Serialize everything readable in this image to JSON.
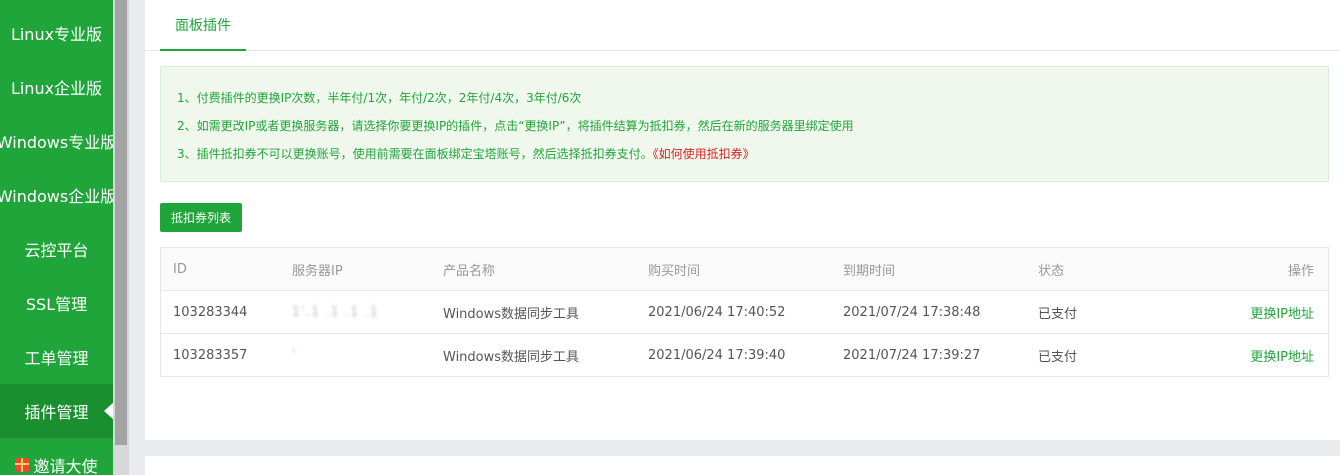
{
  "sidebar": {
    "items": [
      {
        "label": "Linux专业版"
      },
      {
        "label": "Linux企业版"
      },
      {
        "label": "Windows专业版"
      },
      {
        "label": "Windows企业版"
      },
      {
        "label": "云控平台"
      },
      {
        "label": "SSL管理"
      },
      {
        "label": "工单管理"
      },
      {
        "label": "插件管理"
      },
      {
        "label": "邀请大使"
      }
    ],
    "active_index": 7
  },
  "tab": {
    "label": "面板插件"
  },
  "notice": {
    "line1": "1、付费插件的更换IP次数，半年付/1次，年付/2次，2年付/4次，3年付/6次",
    "line2": "2、如需更改IP或者更换服务器，请选择你要更换IP的插件，点击“更换IP”，将插件结算为抵扣券，然后在新的服务器里绑定使用",
    "line3": "3、插件抵扣券不可以更换账号，使用前需要在面板绑定宝塔账号，然后选择抵扣券支付。",
    "line3_link": "《如何使用抵扣券》"
  },
  "buttons": {
    "coupon_list": "抵扣券列表"
  },
  "table": {
    "headers": {
      "id": "ID",
      "server_ip": "服务器IP",
      "product": "产品名称",
      "buy_time": "购买时间",
      "expire_time": "到期时间",
      "status": "状态",
      "action": "操作"
    },
    "rows": [
      {
        "id": "103283344",
        "server_ip": "1'.1 .1 .1 .1",
        "product": "Windows数据同步工具",
        "buy_time": "2021/06/24 17:40:52",
        "expire_time": "2021/07/24 17:38:48",
        "status": "已支付",
        "action": "更换IP地址"
      },
      {
        "id": "103283357",
        "server_ip": "'",
        "product": "Windows数据同步工具",
        "buy_time": "2021/06/24 17:39:40",
        "expire_time": "2021/07/24 17:39:27",
        "status": "已支付",
        "action": "更换IP地址"
      }
    ]
  },
  "colors": {
    "brand_green": "#20a53a",
    "link_red": "#e02020"
  }
}
